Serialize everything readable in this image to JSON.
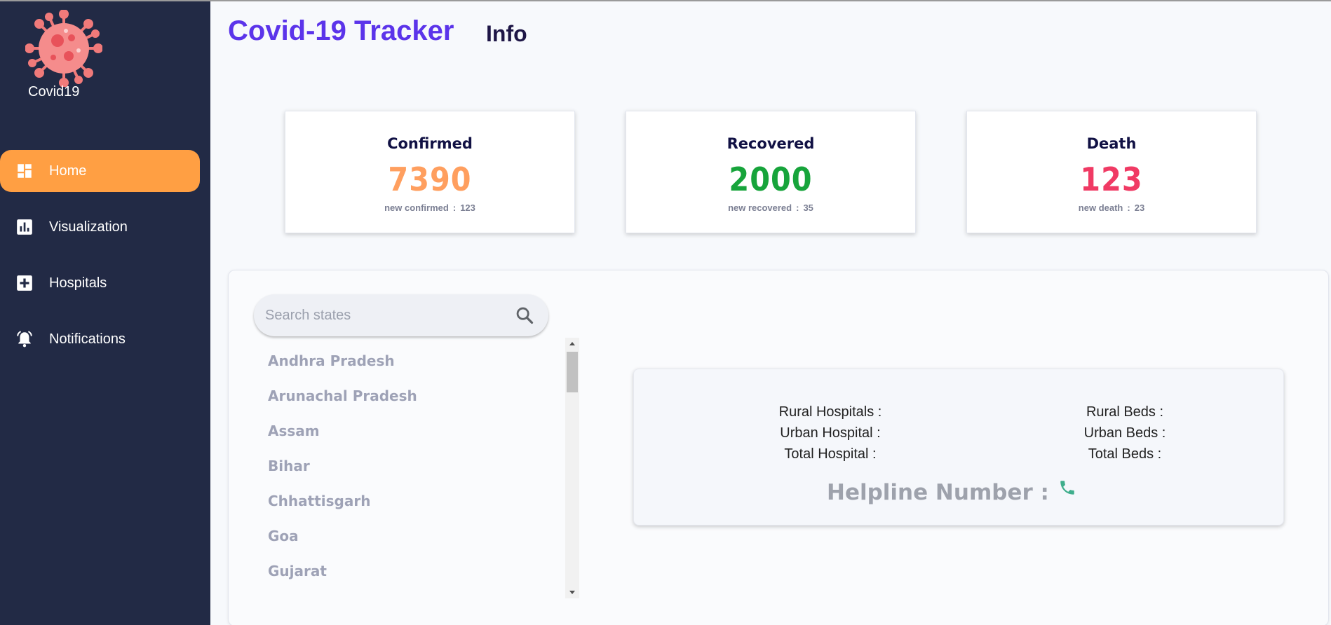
{
  "app": {
    "logo_label": "Covid19"
  },
  "header": {
    "title": "Covid-19 Tracker",
    "subtitle": "Info"
  },
  "nav": {
    "items": [
      {
        "label": "Home",
        "icon": "dashboard-icon",
        "active": true
      },
      {
        "label": "Visualization",
        "icon": "bar-chart-icon",
        "active": false
      },
      {
        "label": "Hospitals",
        "icon": "hospital-plus-icon",
        "active": false
      },
      {
        "label": "Notifications",
        "icon": "bell-icon",
        "active": false
      }
    ]
  },
  "cards": [
    {
      "title": "Confirmed",
      "value": "7390",
      "sub_label": "new confirmed",
      "sub_sep": ":",
      "sub_value": "123",
      "color": "#ff9f5f"
    },
    {
      "title": "Recovered",
      "value": "2000",
      "sub_label": "new recovered",
      "sub_sep": ":",
      "sub_value": "35",
      "color": "#17a43b"
    },
    {
      "title": "Death",
      "value": "123",
      "sub_label": "new death",
      "sub_sep": ":",
      "sub_value": "23",
      "color": "#f03a64"
    }
  ],
  "search": {
    "placeholder": "Search states",
    "value": ""
  },
  "states": [
    "Andhra Pradesh",
    "Arunachal Pradesh",
    "Assam",
    "Bihar",
    "Chhattisgarh",
    "Goa",
    "Gujarat"
  ],
  "hospital_info": {
    "rural_hospitals": "Rural Hospitals :",
    "urban_hospital": "Urban Hospital :",
    "total_hospital": "Total Hospital :",
    "rural_beds": "Rural Beds :",
    "urban_beds": "Urban Beds :",
    "total_beds": "Total Beds :",
    "helpline": "Helpline Number :"
  },
  "colors": {
    "sidebar": "#222a45",
    "active_nav": "#ff9f43",
    "title": "#5b34ea",
    "phone": "#3fae8c"
  }
}
